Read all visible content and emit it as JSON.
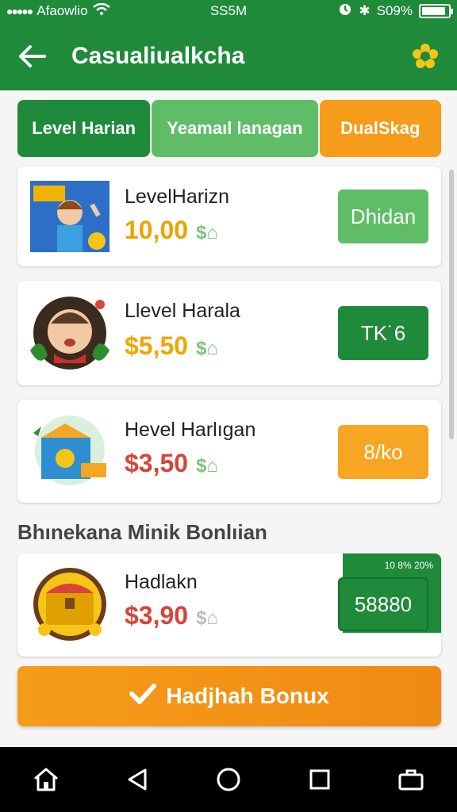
{
  "status": {
    "carrier": "Afaowlio",
    "time": "SS5M",
    "battery": "S09%",
    "battery_level": 0.9
  },
  "header": {
    "title": "Casualiualkcha"
  },
  "tabs": [
    {
      "label": "Level Harian"
    },
    {
      "label": "Yeamaıl lanagan"
    },
    {
      "label": "DualSkag"
    }
  ],
  "items": [
    {
      "name": "LevelHarizn",
      "price": "10,00",
      "coin": "$⌂",
      "button": "Dhidan",
      "price_color": "#e9a400",
      "button_color": "#5fbd67"
    },
    {
      "name": "Llevel Harala",
      "price": "$5,50",
      "coin": "$⌂",
      "button": "TK˙6",
      "price_color": "#f0a500",
      "button_color": "#1f8a3a"
    },
    {
      "name": "Hevel Harlıgan",
      "price": "$3,50",
      "coin": "$⌂",
      "button": "8/ko",
      "price_color": "#d9433a",
      "button_color": "#f6a623"
    }
  ],
  "section": {
    "title": "Bhınekana Minik Bonlıian"
  },
  "bonus_item": {
    "name": "Hadlakn",
    "price": "$3,90",
    "coin": "$⌂",
    "badge": "10 8% 20%",
    "button": "58880",
    "price_color": "#d9433a"
  },
  "claim_button": {
    "label": "Hadjhah Bonux"
  },
  "colors": {
    "primary": "#1f8a3a",
    "light_green": "#5fbd67",
    "orange": "#f59c1a"
  }
}
